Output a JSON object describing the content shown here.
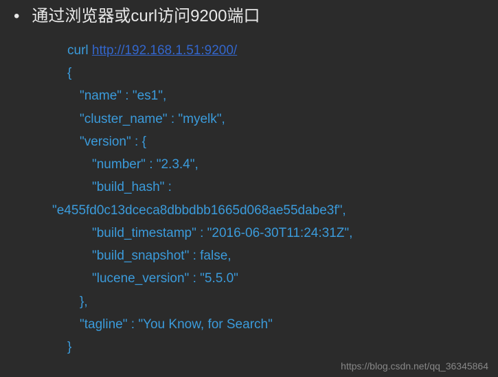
{
  "header": {
    "bullet": "•",
    "title": "通过浏览器或curl访问9200端口"
  },
  "code": {
    "curl_cmd": "curl ",
    "url": "http://192.168.1.51:9200/",
    "open_brace": "{",
    "name_line": "\"name\" : \"es1\",",
    "cluster_line": "\"cluster_name\" : \"myelk\",",
    "version_open": "\"version\" : {",
    "number_line": "\"number\" : \"2.3.4\",",
    "build_hash_label": "\"build_hash\" :",
    "build_hash_value": "\"e455fd0c13dceca8dbbdbb1665d068ae55dabe3f\",",
    "build_timestamp_line": "\"build_timestamp\" : \"2016-06-30T11:24:31Z\",",
    "build_snapshot_line": "\"build_snapshot\" : false,",
    "lucene_line": "\"lucene_version\" : \"5.5.0\"",
    "version_close": "},",
    "tagline_line": "\"tagline\" : \"You Know, for Search\"",
    "close_brace": "}"
  },
  "watermark": "https://blog.csdn.net/qq_36345864"
}
